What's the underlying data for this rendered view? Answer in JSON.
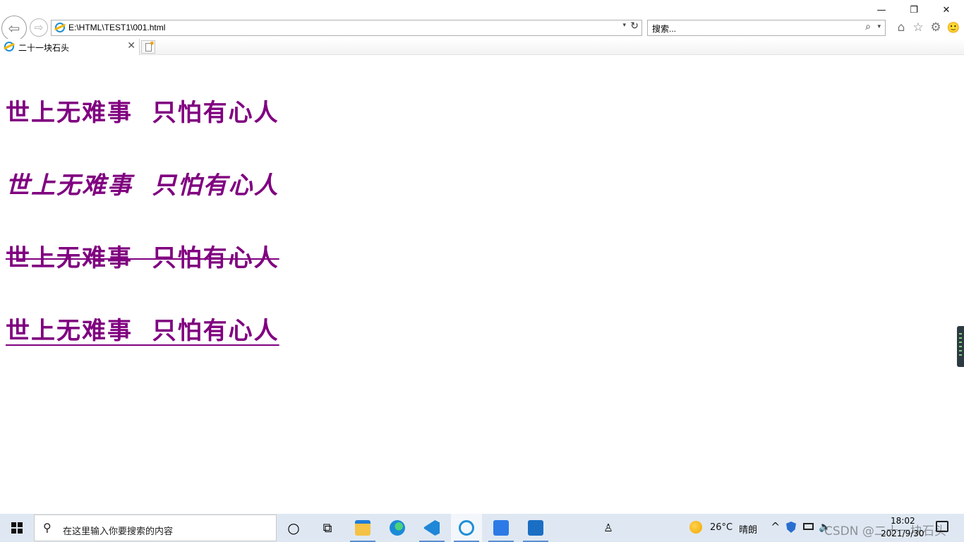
{
  "window": {
    "minimize_glyph": "—",
    "restore_glyph": "❐",
    "close_glyph": "✕"
  },
  "toolbar": {
    "back_glyph": "⇦",
    "forward_glyph": "⇨",
    "address": "E:\\HTML\\TEST1\\001.html",
    "dropdown_glyph": "▾",
    "refresh_glyph": "↻",
    "search_placeholder": "搜索...",
    "search_glyph": "⌕",
    "home_glyph": "⌂",
    "favorites_glyph": "☆",
    "tools_glyph": "⚙",
    "smiley_glyph": "🙂"
  },
  "tabs": [
    {
      "title": "二十一块石头",
      "close_glyph": "✕"
    }
  ],
  "page": {
    "lines": [
      "世上无难事  只怕有心人",
      "世上无难事  只怕有心人",
      "世上无难事  只怕有心人",
      "世上无难事  只怕有心人"
    ],
    "text_color": "#800080"
  },
  "taskbar": {
    "search_placeholder": "在这里输入你要搜索的内容",
    "search_glyph": "⚲",
    "cortana_glyph": "○",
    "taskview_glyph": "⧉",
    "people_glyph": "♙",
    "weather_temp": "26°C",
    "weather_desc": "晴朗",
    "tray_up_glyph": "^",
    "volume_glyph": "🔈",
    "time": "18:02",
    "date": "2021/9/30",
    "watermark": "CSDN @二十一块石头"
  }
}
